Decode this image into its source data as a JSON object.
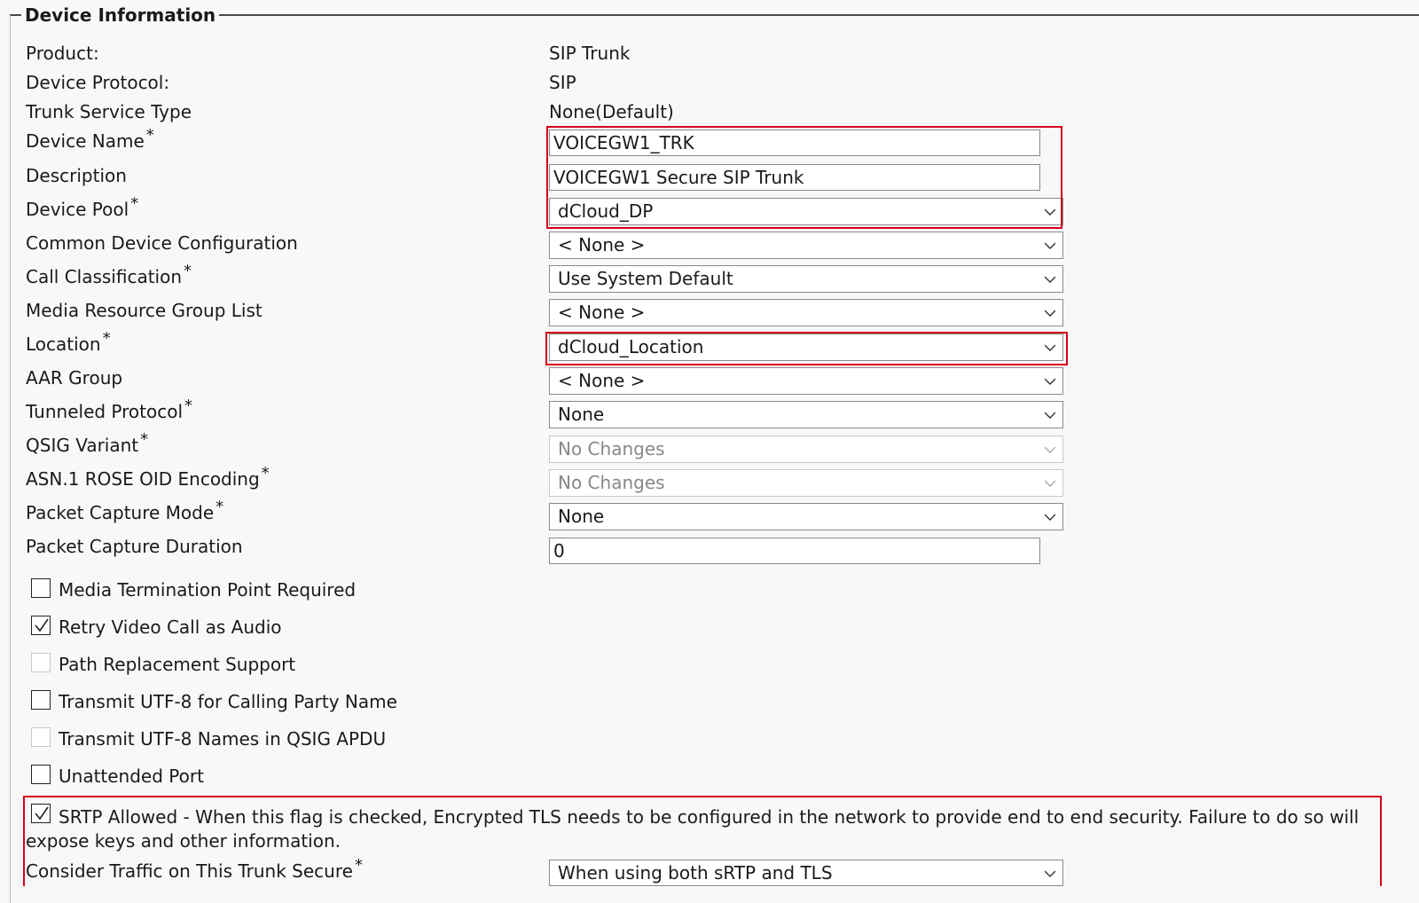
{
  "section": {
    "legend": "Device Information"
  },
  "info": [
    {
      "label": "Product:",
      "value": "SIP Trunk"
    },
    {
      "label": "Device Protocol:",
      "value": "SIP"
    },
    {
      "label": "Trunk Service Type",
      "value": "None(Default)"
    }
  ],
  "fields": {
    "device_name": {
      "label": "Device Name",
      "value": "VOICEGW1_TRK"
    },
    "description": {
      "label": "Description",
      "value": "VOICEGW1 Secure SIP Trunk"
    },
    "device_pool": {
      "label": "Device Pool",
      "value": "dCloud_DP"
    },
    "common_device_configuration": {
      "label": "Common Device Configuration",
      "value": "< None >"
    },
    "call_classification": {
      "label": "Call Classification",
      "value": "Use System Default"
    },
    "media_resource_group_list": {
      "label": "Media Resource Group List",
      "value": "< None >"
    },
    "location": {
      "label": "Location",
      "value": "dCloud_Location"
    },
    "aar_group": {
      "label": "AAR Group",
      "value": "< None >"
    },
    "tunneled_protocol": {
      "label": "Tunneled Protocol",
      "value": "None"
    },
    "qsig_variant": {
      "label": "QSIG Variant",
      "value": "No Changes"
    },
    "asn1_rose_oid_encoding": {
      "label": "ASN.1 ROSE OID Encoding",
      "value": "No Changes"
    },
    "packet_capture_mode": {
      "label": "Packet Capture Mode",
      "value": "None"
    },
    "packet_capture_duration": {
      "label": "Packet Capture Duration",
      "value": "0"
    },
    "consider_traffic_secure": {
      "label": "Consider Traffic on This Trunk Secure",
      "value": "When using both sRTP and TLS"
    }
  },
  "required_marker": "*",
  "checkboxes": {
    "media_termination_point_required": {
      "label": "Media Termination Point Required",
      "checked": false,
      "disabled": false
    },
    "retry_video_call_as_audio": {
      "label": "Retry Video Call as Audio",
      "checked": true,
      "disabled": false
    },
    "path_replacement_support": {
      "label": "Path Replacement Support",
      "checked": false,
      "disabled": true
    },
    "transmit_utf8_calling_party_name": {
      "label": "Transmit UTF-8 for Calling Party Name",
      "checked": false,
      "disabled": false
    },
    "transmit_utf8_names_qsig_apdu": {
      "label": "Transmit UTF-8 Names in QSIG APDU",
      "checked": false,
      "disabled": true
    },
    "unattended_port": {
      "label": "Unattended Port",
      "checked": false,
      "disabled": false
    },
    "srtp_allowed": {
      "label": "SRTP Allowed - When this flag is checked, Encrypted TLS needs to be configured in the network to provide end to end security. Failure to do so will expose keys and other information.",
      "checked": true,
      "disabled": false
    }
  },
  "colors": {
    "highlight": "#d6001c",
    "disabled_text": "#888888"
  }
}
